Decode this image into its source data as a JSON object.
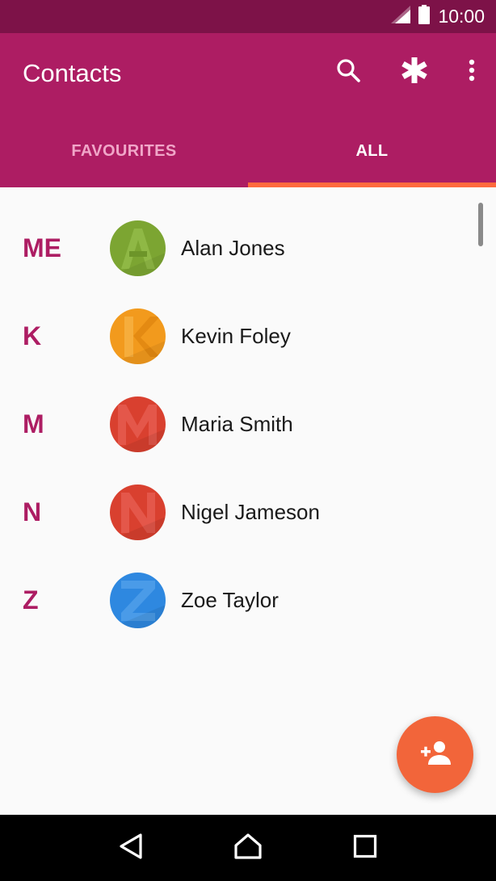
{
  "status_bar": {
    "time": "10:00",
    "icons": [
      "signal-icon",
      "battery-icon"
    ]
  },
  "app_bar": {
    "title": "Contacts",
    "actions": [
      "search-icon",
      "asterisk-icon",
      "more-vert-icon"
    ]
  },
  "tabs": [
    {
      "label": "FAVOURITES",
      "active": false
    },
    {
      "label": "ALL",
      "active": true
    }
  ],
  "contacts": [
    {
      "section": "ME",
      "name": "Alan Jones",
      "avatar_color": "#7ca532",
      "avatar_letter": "A"
    },
    {
      "section": "K",
      "name": "Kevin Foley",
      "avatar_color": "#f29a1d",
      "avatar_letter": "K"
    },
    {
      "section": "M",
      "name": "Maria Smith",
      "avatar_color": "#d9402f",
      "avatar_letter": "M"
    },
    {
      "section": "N",
      "name": "Nigel Jameson",
      "avatar_color": "#d9402f",
      "avatar_letter": "N"
    },
    {
      "section": "Z",
      "name": "Zoe Taylor",
      "avatar_color": "#2e88e0",
      "avatar_letter": "Z"
    }
  ],
  "fab": {
    "icon": "add-person-icon"
  },
  "nav_bar": {
    "buttons": [
      "back-icon",
      "home-icon",
      "recents-icon"
    ]
  },
  "colors": {
    "primary": "#ad1d63",
    "primary_dark": "#7d1248",
    "accent": "#f2653a",
    "tab_indicator": "#ff6a3d"
  }
}
